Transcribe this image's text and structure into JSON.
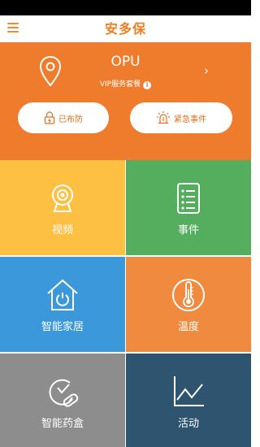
{
  "header": {
    "title": "安多保"
  },
  "device": {
    "name": "OPU",
    "plan": "VIP服务套餐",
    "info_glyph": "i",
    "chevron": "›"
  },
  "actions": {
    "armed_label": "已布防",
    "emergency_label": "紧急事件"
  },
  "tiles": [
    {
      "label": "视频",
      "icon": "camera-icon",
      "color": "#fec042"
    },
    {
      "label": "事件",
      "icon": "event-list-icon",
      "color": "#55ae5e"
    },
    {
      "label": "智能家居",
      "icon": "smart-home-icon",
      "color": "#3b98db"
    },
    {
      "label": "温度",
      "icon": "thermometer-icon",
      "color": "#f08a3f"
    },
    {
      "label": "智能药盒",
      "icon": "pill-clock-icon",
      "color": "#8d8d8d"
    },
    {
      "label": "活动",
      "icon": "activity-chart-icon",
      "color": "#2e5470"
    }
  ],
  "colors": {
    "brand": "#ef7d22",
    "hero": "#ee7c2c"
  }
}
